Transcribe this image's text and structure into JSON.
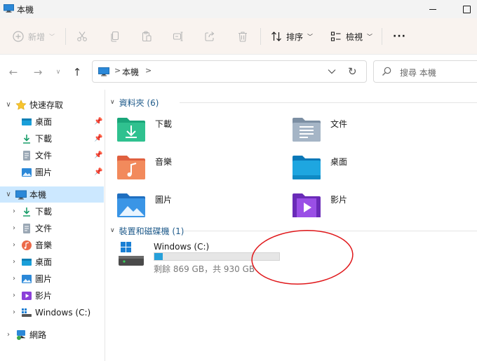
{
  "window": {
    "title": "本機"
  },
  "commandbar": {
    "new_label": "新增",
    "sort_label": "排序",
    "view_label": "檢視",
    "more_label": "···"
  },
  "address": {
    "crumb": "本機",
    "search_placeholder": "搜尋 本機"
  },
  "sidebar": {
    "quick_access": "快速存取",
    "quick_items": [
      {
        "label": "桌面"
      },
      {
        "label": "下載"
      },
      {
        "label": "文件"
      },
      {
        "label": "圖片"
      }
    ],
    "this_pc": "本機",
    "pc_items": [
      {
        "label": "下載"
      },
      {
        "label": "文件"
      },
      {
        "label": "音樂"
      },
      {
        "label": "桌面"
      },
      {
        "label": "圖片"
      },
      {
        "label": "影片"
      },
      {
        "label": "Windows (C:)"
      }
    ],
    "network": "網路"
  },
  "content": {
    "folders_header": "資料夾 (6)",
    "folders": [
      {
        "name": "下載"
      },
      {
        "name": "文件"
      },
      {
        "name": "音樂"
      },
      {
        "name": "桌面"
      },
      {
        "name": "圖片"
      },
      {
        "name": "影片"
      }
    ],
    "devices_header": "裝置和磁碟機 (1)",
    "drive": {
      "name": "Windows (C:)",
      "space_text": "剩餘 869 GB，共 930 GB",
      "used_fraction": 0.066
    }
  },
  "colors": {
    "accent": "#26a0da",
    "selection": "#cce8ff",
    "annotation": "#e0181b"
  }
}
